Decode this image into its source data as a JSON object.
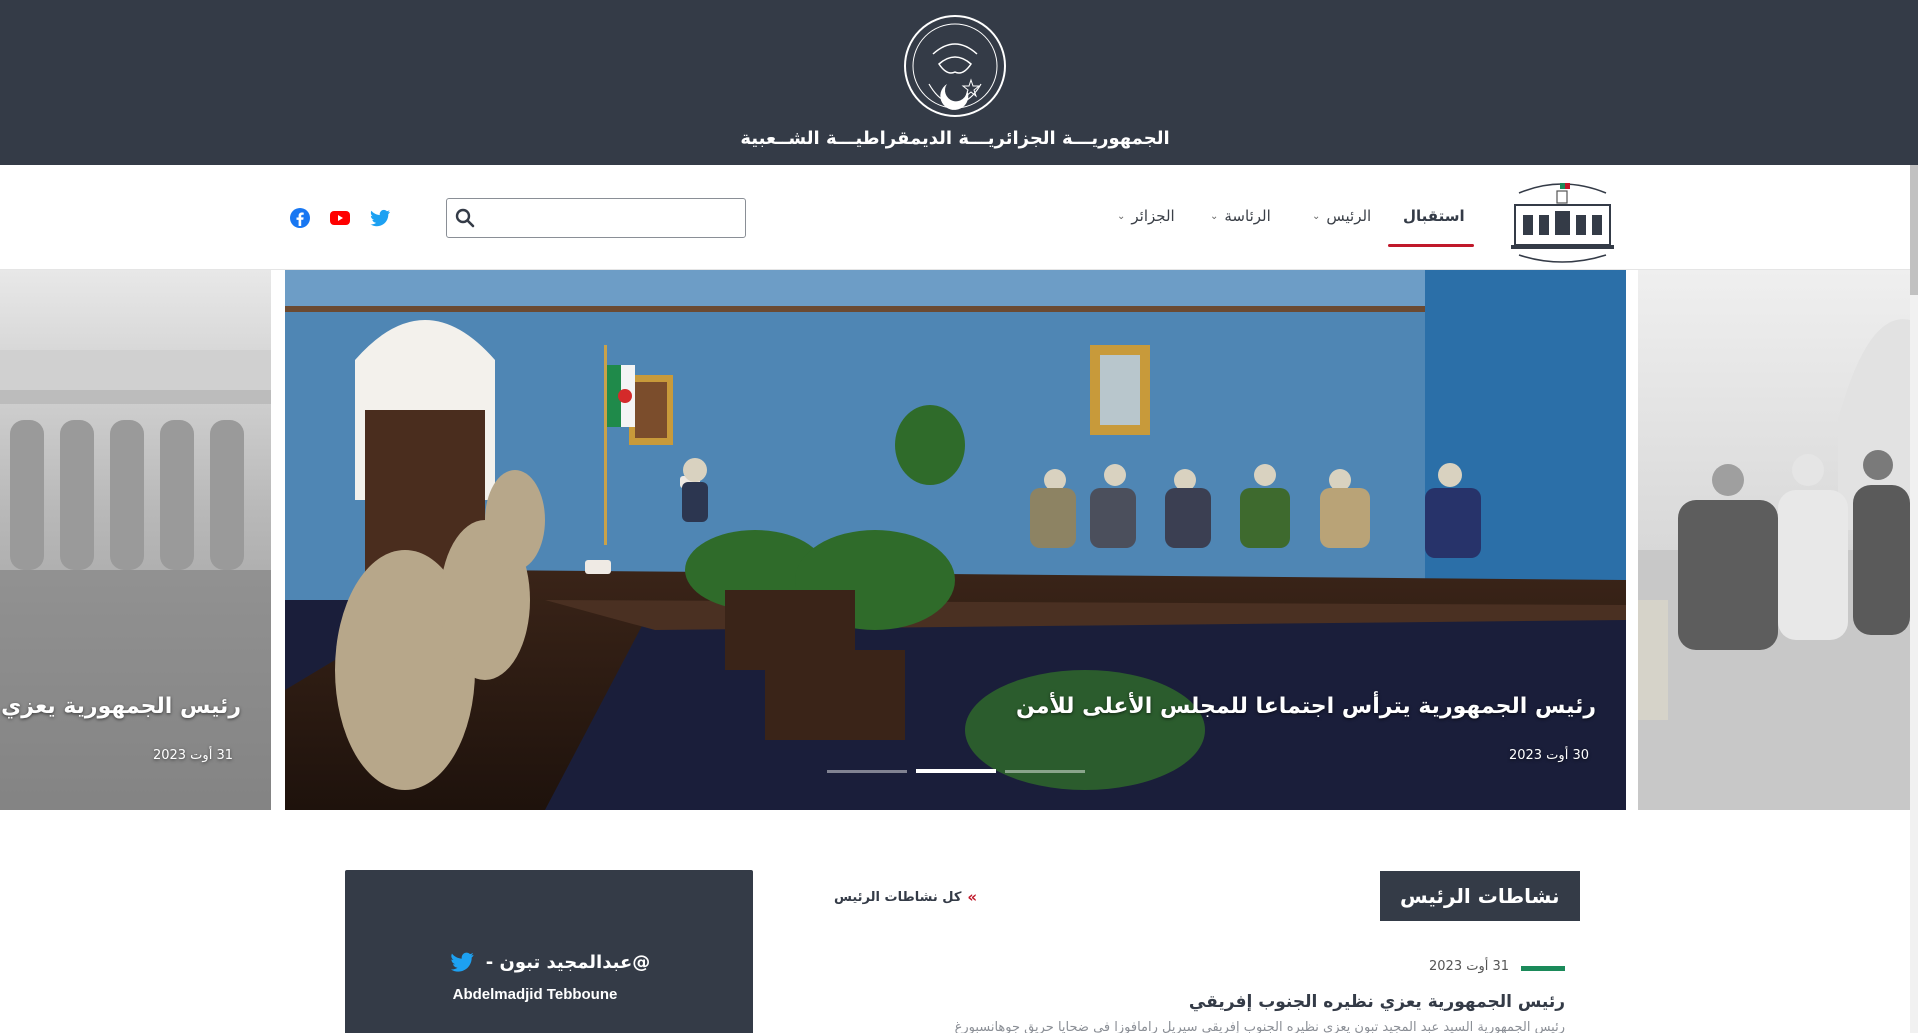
{
  "header": {
    "republic_title": "الجمهوريـــة الجزائريـــة الديمقراطيـــة الشــعبية"
  },
  "nav": {
    "home": "استقبال",
    "president": "الرئيس",
    "presidency": "الرئاسة",
    "algeria": "الجزائر",
    "search_placeholder": ""
  },
  "social_icons": [
    "twitter-icon",
    "youtube-icon",
    "facebook-icon"
  ],
  "colors": {
    "banner": "#343b47",
    "accent_red": "#c0182a",
    "accent_green": "#1b8a5a",
    "twitter_blue": "#1da1f2",
    "youtube_red": "#ff0000",
    "facebook_blue": "#1877f2"
  },
  "slider": {
    "main": {
      "title": "رئيس الجمهورية يترأس اجتماعا للمجلس الأعلى للأمن",
      "date": "30 أوت 2023"
    },
    "left": {
      "title": "رئيس الجمهورية يعزي نظيره",
      "date": "31 أوت 2023"
    },
    "active_dot": 1,
    "dot_count": 3
  },
  "activities": {
    "heading": "نشاطات الرئيس",
    "all_link": "كل نشاطات الرئيس",
    "item": {
      "date": "31 أوت 2023",
      "title": "رئيس الجمهورية يعزي نظيره الجنوب إفريقي",
      "excerpt": "رئيس الجمهورية السيد عبد المجيد تبون يعزي نظيره الجنوب إفريقي سيريل رامافوزا في ضحايا حريق جوهانسبورغ"
    }
  },
  "twitter_card": {
    "handle": "@عبدالمجيد تبون -",
    "name": "Abdelmadjid Tebboune"
  }
}
